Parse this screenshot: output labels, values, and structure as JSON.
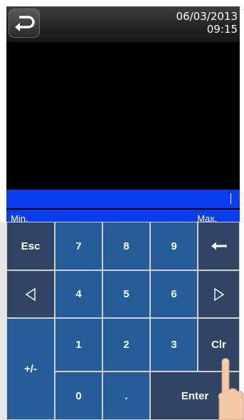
{
  "header": {
    "date": "06/03/2013",
    "time": "09:15",
    "back_icon": "back-arrow-icon"
  },
  "range": {
    "min_label": "Min. _ _",
    "max_label": "Max. _ _"
  },
  "keys": {
    "esc": "Esc",
    "seven": "7",
    "eight": "8",
    "nine": "9",
    "four": "4",
    "five": "5",
    "six": "6",
    "one": "1",
    "two": "2",
    "three": "3",
    "clr": "Clr",
    "plusminus": "+/-",
    "zero": "0",
    "dot": ".",
    "enter": "Enter",
    "backspace_icon": "backspace-arrow-icon",
    "left_icon": "left-triangle-icon",
    "right_icon": "right-triangle-icon"
  },
  "colors": {
    "input_bar": "#0a3cf0",
    "number_key": "#265c97",
    "function_key": "#304563"
  }
}
